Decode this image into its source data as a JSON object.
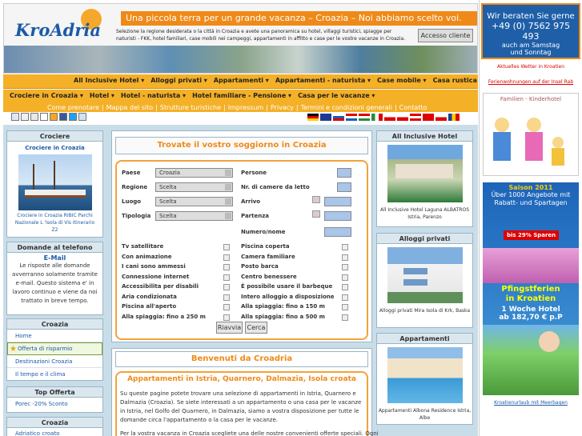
{
  "header": {
    "logo_text": "KroAdria",
    "tagline": "Una piccola terra per un grande vacanza – Croazia – Noi abbiamo scelto voi.",
    "intro": "Selezione la regione desiderata o la città in Croazia e avete una panoramica su hotel, villaggi turistici, spiagge per naturisti - FKK, hotel familiari, case mobili nei campeggi, appartamenti in affitto e case per le vostre vacanze in Croazia.",
    "access_button": "Accesso cliente"
  },
  "nav1": [
    "All Inclusive Hotel ▾",
    "Alloggi privati ▾",
    "Appartamenti ▾",
    "Appartamenti - naturista ▾",
    "Case mobile ▾",
    "Casa rustica ▾"
  ],
  "nav2": [
    "Crociere in Croazia ▾",
    "Hotel ▾",
    "Hotel - naturista ▾",
    "Hotel familiare - Pensione ▾",
    "Casa per le vacanze ▾"
  ],
  "nav3": [
    "Come prenotare",
    "|",
    "Mappa del sito",
    "|",
    "Strutture turistiche",
    "|",
    "Impressum",
    "|",
    "Privacy",
    "|",
    "Termini e condizioni generali",
    "|",
    "Contatto"
  ],
  "left": {
    "crociere": {
      "title": "Crociere",
      "link": "Crociere in Croazia",
      "caption": "Crociere in Croazia RIBIC Parchi Nazionale L 'isola di Vis Itinerario Z2"
    },
    "domande": {
      "title": "Domande al telefono",
      "email": "E-Mail",
      "text": "Le risposte alle domande avverranno solamente tramite e-mail. Questo sistema e' in lavoro continuo e viene da noi trattato in breve tempo."
    },
    "croazia": {
      "title": "Croazia",
      "items": [
        "Home",
        "Offerta di risparmio",
        "Destinazioni Croazia",
        "Il tempo e il clima"
      ]
    },
    "topofferta": {
      "title": "Top Offerta",
      "item": "Porec -20% Sconto"
    },
    "croazia2": {
      "title": "Croazia",
      "item": "Adriatico croato"
    }
  },
  "search": {
    "title": "Trovate il vostro soggiorno in Croazia",
    "labels_left": [
      "Paese",
      "Regione",
      "Luogo",
      "Tipologia"
    ],
    "values_left": [
      "Croazia",
      "Scelta",
      "Scelta",
      "Scelta"
    ],
    "labels_right": [
      "Persone",
      "Nr. di camere da letto",
      "Arrivo",
      "Partenza",
      "Numero/nome"
    ],
    "features_left": [
      "Tv satellitare",
      "Con animazione",
      "I cani sono ammessi",
      "Connessione internet",
      "Accessibilita per disabili",
      "Aria condizionata",
      "Piscina all'aperto",
      "Alla spiaggia: fino a 250 m"
    ],
    "features_right": [
      "Piscina coperta",
      "Camera familiare",
      "Posto barca",
      "Centro benessere",
      "È possibile usare il barbeque",
      "Intero alloggio a disposizione",
      "Alla spiaggia: fino a 150 m",
      "Alla spiaggia: fino a 500 m"
    ],
    "btn_reset": "Riavvia",
    "btn_search": "Cerca"
  },
  "welcome": {
    "title": "Benvenuti da Croadria",
    "subtitle": "Appartamenti in Istria, Quarnero, Dalmazia, Isola croata",
    "p1": "Su queste pagine potete trovare una selezione di appartamenti in Istria, Quarnero e Dalmazia (Croazia). Se siete interessati a un appartamento o una casa per le vacanze in Istria, nel Golfo del Quarnero, in Dalmazia, siamo a vostra disposizione per tutte le domande circa l'appartamento o la casa per le vacanze.",
    "p2": "Per la vostra vacanza in Croazia scegliete una delle nostre convenienti offerte speciali. Ogni"
  },
  "mid": {
    "allinc": {
      "title": "All Inclusive Hotel",
      "caption": "All Inclusive Hotel Laguna ALBATROS Istria, Parenzo"
    },
    "alloggi": {
      "title": "Alloggi privati",
      "caption": "Alloggi privati Mira Isola di Krk, Baska"
    },
    "app": {
      "title": "Appartamenti",
      "caption": "Appartamenti Albona Residence Istria, Albe"
    }
  },
  "right": {
    "ad1": [
      "Wir beraten Sie gerne",
      "+49 (0) 7562 975 493",
      "auch am Samstag",
      "und Sonntag"
    ],
    "wetter": "Aktuelles Wetter in Kroatien",
    "feriw": "Ferienwohnungen auf der Insel Rab",
    "family": "Familien - Kinderhotel",
    "season": "Saison 2011",
    "over": "Über 1000 Angebote mit Rabatt- und Spartagen",
    "sparen": "bis 29% Sparen",
    "pfingst": [
      "Pfingstferien",
      "in Kroatien",
      "1 Woche Hotel",
      "ab 182,70 € p.P"
    ],
    "link": "Kroatienurlaub mit Meerbagen"
  }
}
